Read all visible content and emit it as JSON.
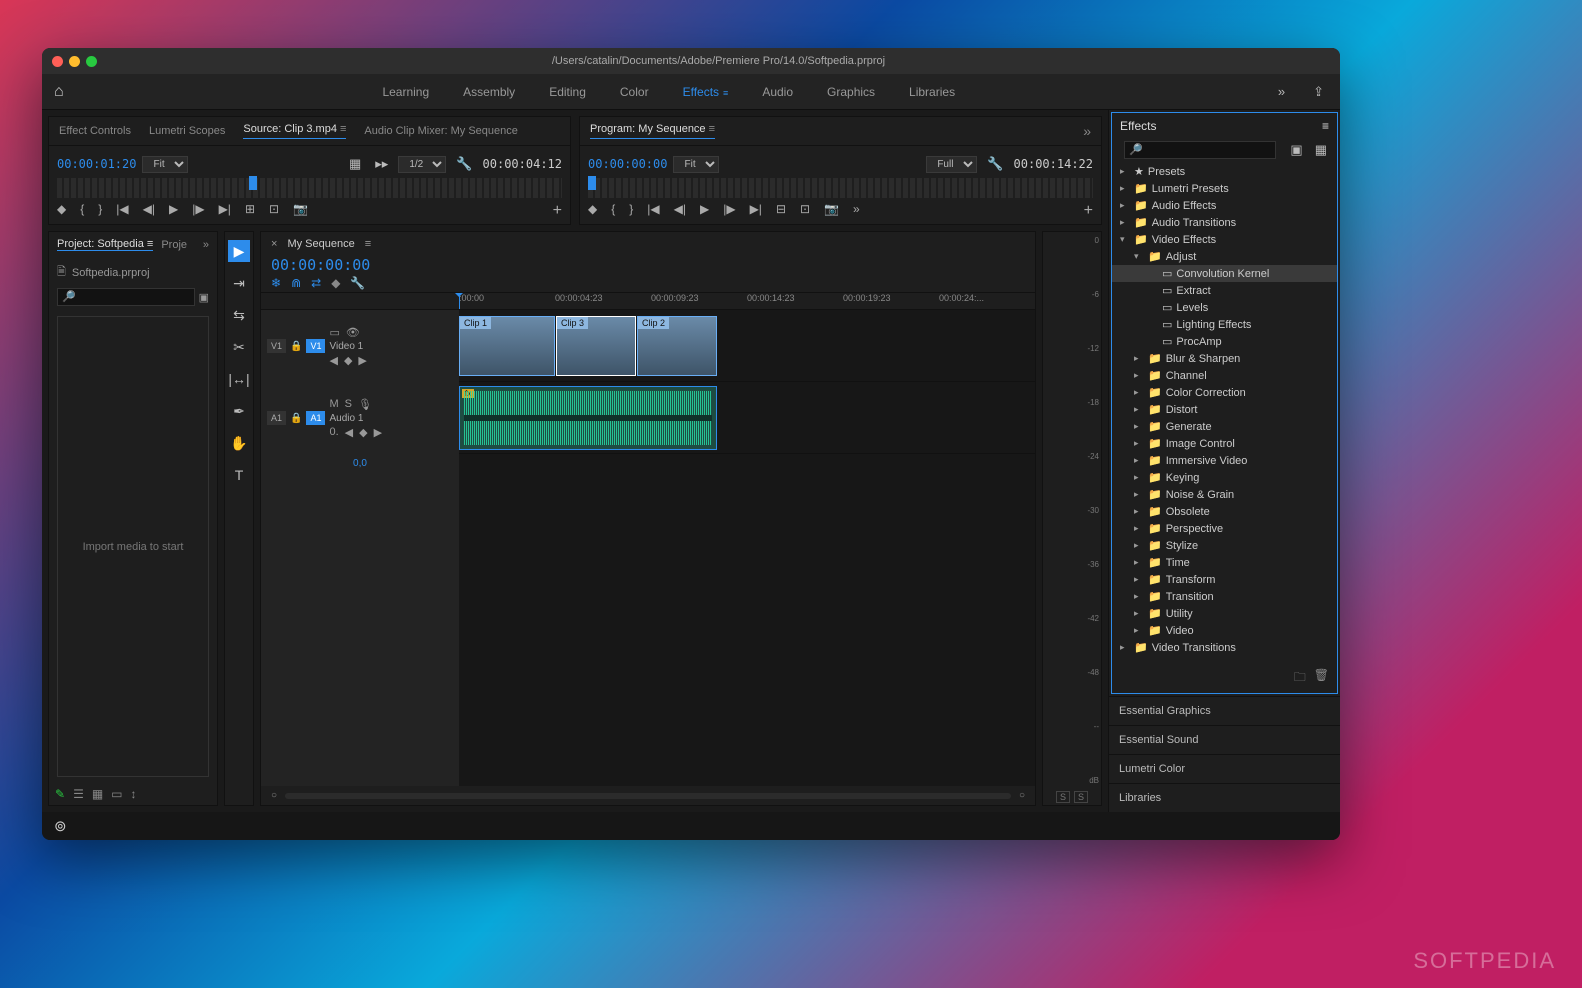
{
  "titlebar": {
    "title": "/Users/catalin/Documents/Adobe/Premiere Pro/14.0/Softpedia.prproj"
  },
  "workspace": {
    "tabs": [
      "Learning",
      "Assembly",
      "Editing",
      "Color",
      "Effects",
      "Audio",
      "Graphics",
      "Libraries"
    ],
    "active": "Effects"
  },
  "source_panel": {
    "tabs": [
      "Effect Controls",
      "Lumetri Scopes",
      "Source: Clip 3.mp4",
      "Audio Clip Mixer: My Sequence"
    ],
    "active": "Source: Clip 3.mp4",
    "tc_in": "00:00:01:20",
    "tc_dur": "00:00:04:12",
    "zoom": "Fit",
    "res": "1/2"
  },
  "program_panel": {
    "title": "Program: My Sequence",
    "tc_in": "00:00:00:00",
    "tc_dur": "00:00:14:22",
    "zoom": "Fit",
    "res": "Full"
  },
  "project": {
    "tab1": "Project: Softpedia",
    "tab2": "Proje",
    "filename": "Softpedia.prproj",
    "import_hint": "Import media to start"
  },
  "timeline": {
    "sequence": "My Sequence",
    "tc": "00:00:00:00",
    "ruler": [
      ":00:00",
      "00:00:04:23",
      "00:00:09:23",
      "00:00:14:23",
      "00:00:19:23",
      "00:00:24:..."
    ],
    "v1_label": "V1",
    "v1_name": "Video 1",
    "a1_label": "A1",
    "a1_name": "Audio 1",
    "clips": [
      "Clip 1",
      "Clip 3",
      "Clip 2"
    ],
    "linked": "0,0"
  },
  "meters": {
    "scale": [
      "0",
      "-6",
      "-12",
      "-18",
      "-24",
      "-30",
      "-36",
      "-42",
      "-48",
      "--",
      "dB"
    ]
  },
  "effects": {
    "title": "Effects",
    "tree": [
      {
        "d": 1,
        "chev": ">",
        "ic": "★",
        "label": "Presets"
      },
      {
        "d": 1,
        "chev": ">",
        "ic": "📁",
        "label": "Lumetri Presets"
      },
      {
        "d": 1,
        "chev": ">",
        "ic": "📁",
        "label": "Audio Effects"
      },
      {
        "d": 1,
        "chev": ">",
        "ic": "📁",
        "label": "Audio Transitions"
      },
      {
        "d": 1,
        "chev": "v",
        "ic": "📁",
        "label": "Video Effects"
      },
      {
        "d": 2,
        "chev": "v",
        "ic": "📁",
        "label": "Adjust"
      },
      {
        "d": 3,
        "chev": "",
        "ic": "▭",
        "label": "Convolution Kernel",
        "sel": true
      },
      {
        "d": 3,
        "chev": "",
        "ic": "▭",
        "label": "Extract"
      },
      {
        "d": 3,
        "chev": "",
        "ic": "▭",
        "label": "Levels"
      },
      {
        "d": 3,
        "chev": "",
        "ic": "▭",
        "label": "Lighting Effects"
      },
      {
        "d": 3,
        "chev": "",
        "ic": "▭",
        "label": "ProcAmp"
      },
      {
        "d": 2,
        "chev": ">",
        "ic": "📁",
        "label": "Blur & Sharpen"
      },
      {
        "d": 2,
        "chev": ">",
        "ic": "📁",
        "label": "Channel"
      },
      {
        "d": 2,
        "chev": ">",
        "ic": "📁",
        "label": "Color Correction"
      },
      {
        "d": 2,
        "chev": ">",
        "ic": "📁",
        "label": "Distort"
      },
      {
        "d": 2,
        "chev": ">",
        "ic": "📁",
        "label": "Generate"
      },
      {
        "d": 2,
        "chev": ">",
        "ic": "📁",
        "label": "Image Control"
      },
      {
        "d": 2,
        "chev": ">",
        "ic": "📁",
        "label": "Immersive Video"
      },
      {
        "d": 2,
        "chev": ">",
        "ic": "📁",
        "label": "Keying"
      },
      {
        "d": 2,
        "chev": ">",
        "ic": "📁",
        "label": "Noise & Grain"
      },
      {
        "d": 2,
        "chev": ">",
        "ic": "📁",
        "label": "Obsolete"
      },
      {
        "d": 2,
        "chev": ">",
        "ic": "📁",
        "label": "Perspective"
      },
      {
        "d": 2,
        "chev": ">",
        "ic": "📁",
        "label": "Stylize"
      },
      {
        "d": 2,
        "chev": ">",
        "ic": "📁",
        "label": "Time"
      },
      {
        "d": 2,
        "chev": ">",
        "ic": "📁",
        "label": "Transform"
      },
      {
        "d": 2,
        "chev": ">",
        "ic": "📁",
        "label": "Transition"
      },
      {
        "d": 2,
        "chev": ">",
        "ic": "📁",
        "label": "Utility"
      },
      {
        "d": 2,
        "chev": ">",
        "ic": "📁",
        "label": "Video"
      },
      {
        "d": 1,
        "chev": ">",
        "ic": "📁",
        "label": "Video Transitions"
      }
    ]
  },
  "other_panels": [
    "Essential Graphics",
    "Essential Sound",
    "Lumetri Color",
    "Libraries"
  ],
  "watermark": "SOFTPEDIA"
}
